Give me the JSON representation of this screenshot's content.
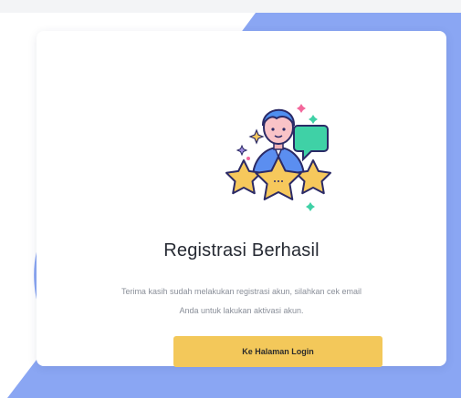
{
  "registration": {
    "title": "Registrasi Berhasil",
    "message_line1": "Terima kasih sudah melakukan registrasi akun, silahkan cek email",
    "message_line2": "Anda untuk lakukan aktivasi akun.",
    "login_button_label": "Ke Halaman Login"
  },
  "colors": {
    "accent_blue": "#8aa6f3",
    "button_yellow": "#f3c85a",
    "star_fill": "#f6c85c",
    "outline": "#2b2a66"
  },
  "icons": {
    "illustration": "user-with-stars-illustration"
  }
}
